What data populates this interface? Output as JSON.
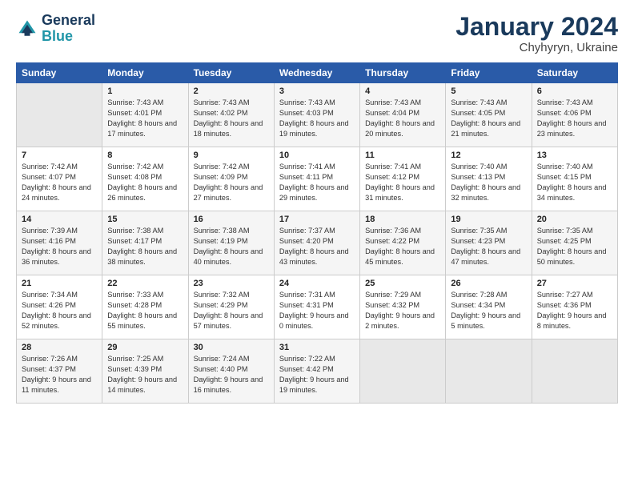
{
  "logo": {
    "text_general": "General",
    "text_blue": "Blue"
  },
  "title": "January 2024",
  "subtitle": "Chyhyryn, Ukraine",
  "days_header": [
    "Sunday",
    "Monday",
    "Tuesday",
    "Wednesday",
    "Thursday",
    "Friday",
    "Saturday"
  ],
  "weeks": [
    [
      {
        "day": "",
        "empty": true
      },
      {
        "day": "1",
        "sunrise": "7:43 AM",
        "sunset": "4:01 PM",
        "daylight": "8 hours and 17 minutes."
      },
      {
        "day": "2",
        "sunrise": "7:43 AM",
        "sunset": "4:02 PM",
        "daylight": "8 hours and 18 minutes."
      },
      {
        "day": "3",
        "sunrise": "7:43 AM",
        "sunset": "4:03 PM",
        "daylight": "8 hours and 19 minutes."
      },
      {
        "day": "4",
        "sunrise": "7:43 AM",
        "sunset": "4:04 PM",
        "daylight": "8 hours and 20 minutes."
      },
      {
        "day": "5",
        "sunrise": "7:43 AM",
        "sunset": "4:05 PM",
        "daylight": "8 hours and 21 minutes."
      },
      {
        "day": "6",
        "sunrise": "7:43 AM",
        "sunset": "4:06 PM",
        "daylight": "8 hours and 23 minutes."
      }
    ],
    [
      {
        "day": "7",
        "sunrise": "7:42 AM",
        "sunset": "4:07 PM",
        "daylight": "8 hours and 24 minutes."
      },
      {
        "day": "8",
        "sunrise": "7:42 AM",
        "sunset": "4:08 PM",
        "daylight": "8 hours and 26 minutes."
      },
      {
        "day": "9",
        "sunrise": "7:42 AM",
        "sunset": "4:09 PM",
        "daylight": "8 hours and 27 minutes."
      },
      {
        "day": "10",
        "sunrise": "7:41 AM",
        "sunset": "4:11 PM",
        "daylight": "8 hours and 29 minutes."
      },
      {
        "day": "11",
        "sunrise": "7:41 AM",
        "sunset": "4:12 PM",
        "daylight": "8 hours and 31 minutes."
      },
      {
        "day": "12",
        "sunrise": "7:40 AM",
        "sunset": "4:13 PM",
        "daylight": "8 hours and 32 minutes."
      },
      {
        "day": "13",
        "sunrise": "7:40 AM",
        "sunset": "4:15 PM",
        "daylight": "8 hours and 34 minutes."
      }
    ],
    [
      {
        "day": "14",
        "sunrise": "7:39 AM",
        "sunset": "4:16 PM",
        "daylight": "8 hours and 36 minutes."
      },
      {
        "day": "15",
        "sunrise": "7:38 AM",
        "sunset": "4:17 PM",
        "daylight": "8 hours and 38 minutes."
      },
      {
        "day": "16",
        "sunrise": "7:38 AM",
        "sunset": "4:19 PM",
        "daylight": "8 hours and 40 minutes."
      },
      {
        "day": "17",
        "sunrise": "7:37 AM",
        "sunset": "4:20 PM",
        "daylight": "8 hours and 43 minutes."
      },
      {
        "day": "18",
        "sunrise": "7:36 AM",
        "sunset": "4:22 PM",
        "daylight": "8 hours and 45 minutes."
      },
      {
        "day": "19",
        "sunrise": "7:35 AM",
        "sunset": "4:23 PM",
        "daylight": "8 hours and 47 minutes."
      },
      {
        "day": "20",
        "sunrise": "7:35 AM",
        "sunset": "4:25 PM",
        "daylight": "8 hours and 50 minutes."
      }
    ],
    [
      {
        "day": "21",
        "sunrise": "7:34 AM",
        "sunset": "4:26 PM",
        "daylight": "8 hours and 52 minutes."
      },
      {
        "day": "22",
        "sunrise": "7:33 AM",
        "sunset": "4:28 PM",
        "daylight": "8 hours and 55 minutes."
      },
      {
        "day": "23",
        "sunrise": "7:32 AM",
        "sunset": "4:29 PM",
        "daylight": "8 hours and 57 minutes."
      },
      {
        "day": "24",
        "sunrise": "7:31 AM",
        "sunset": "4:31 PM",
        "daylight": "9 hours and 0 minutes."
      },
      {
        "day": "25",
        "sunrise": "7:29 AM",
        "sunset": "4:32 PM",
        "daylight": "9 hours and 2 minutes."
      },
      {
        "day": "26",
        "sunrise": "7:28 AM",
        "sunset": "4:34 PM",
        "daylight": "9 hours and 5 minutes."
      },
      {
        "day": "27",
        "sunrise": "7:27 AM",
        "sunset": "4:36 PM",
        "daylight": "9 hours and 8 minutes."
      }
    ],
    [
      {
        "day": "28",
        "sunrise": "7:26 AM",
        "sunset": "4:37 PM",
        "daylight": "9 hours and 11 minutes."
      },
      {
        "day": "29",
        "sunrise": "7:25 AM",
        "sunset": "4:39 PM",
        "daylight": "9 hours and 14 minutes."
      },
      {
        "day": "30",
        "sunrise": "7:24 AM",
        "sunset": "4:40 PM",
        "daylight": "9 hours and 16 minutes."
      },
      {
        "day": "31",
        "sunrise": "7:22 AM",
        "sunset": "4:42 PM",
        "daylight": "9 hours and 19 minutes."
      },
      {
        "day": "",
        "empty": true
      },
      {
        "day": "",
        "empty": true
      },
      {
        "day": "",
        "empty": true
      }
    ]
  ]
}
